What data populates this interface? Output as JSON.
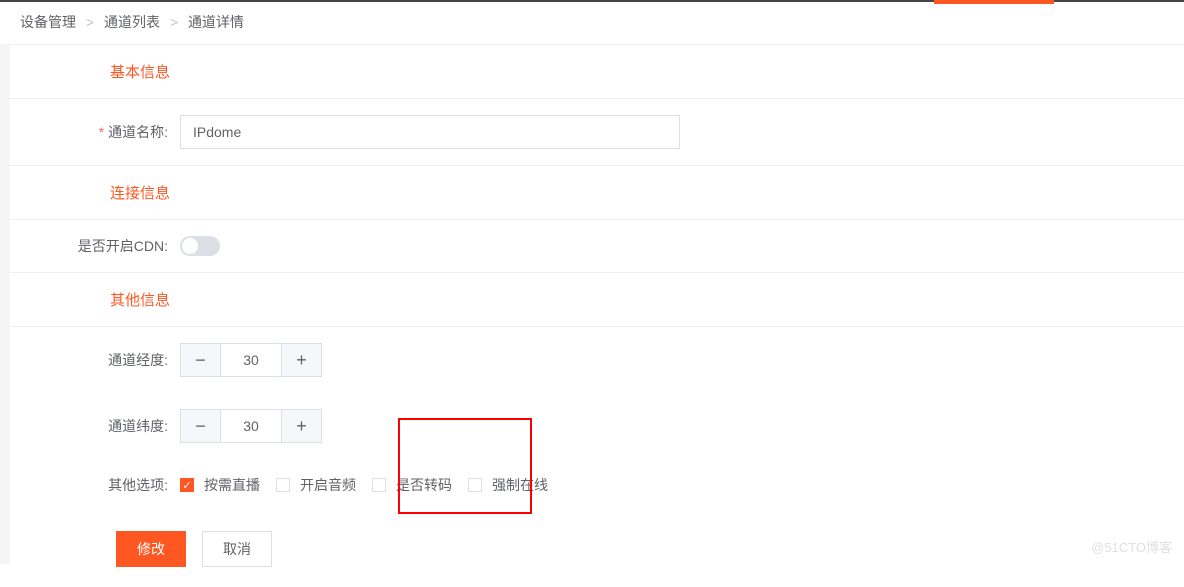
{
  "breadcrumb": {
    "item1": "设备管理",
    "item2": "通道列表",
    "item3": "通道详情",
    "sep": ">"
  },
  "sections": {
    "basic": "基本信息",
    "connection": "连接信息",
    "other": "其他信息"
  },
  "form": {
    "channelNameLabel": "通道名称:",
    "channelNameValue": "IPdome",
    "cdnLabel": "是否开启CDN:",
    "cdnEnabled": false,
    "longitudeLabel": "通道经度:",
    "longitudeValue": "30",
    "latitudeLabel": "通道纬度:",
    "latitudeValue": "30",
    "otherOptionsLabel": "其他选项:",
    "options": {
      "onDemand": {
        "label": "按需直播",
        "checked": true
      },
      "audio": {
        "label": "开启音频",
        "checked": false
      },
      "transcode": {
        "label": "是否转码",
        "checked": false
      },
      "forceOnline": {
        "label": "强制在线",
        "checked": false
      }
    }
  },
  "buttons": {
    "submit": "修改",
    "cancel": "取消"
  },
  "stepper": {
    "minus": "−",
    "plus": "+"
  },
  "check": "✓",
  "watermark": "@51CTO博客"
}
